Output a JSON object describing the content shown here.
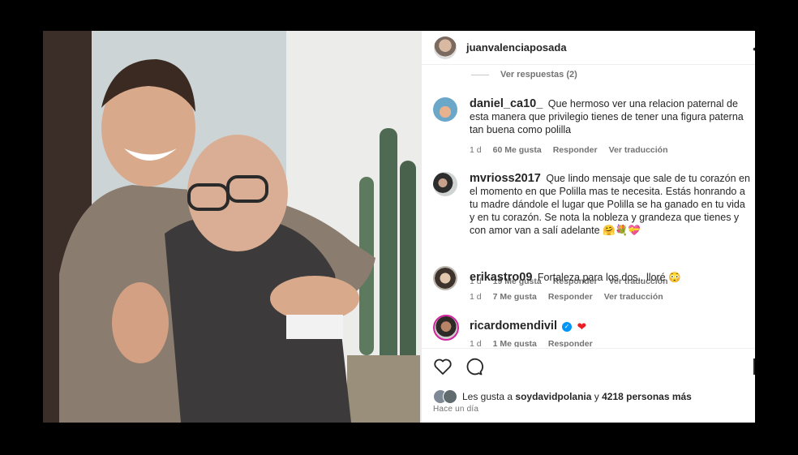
{
  "post": {
    "username": "juanvalenciaposada",
    "more_icon": "more-icon"
  },
  "thread": {
    "view_replies": "Ver respuestas (2)"
  },
  "comments": [
    {
      "username": "daniel_ca10_",
      "text": "Que hermoso ver una relacion paternal de esta manera que privilegio tienes de tener una figura paterna tan buena como polilla",
      "time": "1 d",
      "likes": "60 Me gusta",
      "reply": "Responder",
      "translate": "Ver traducción"
    },
    {
      "username": "mvrioss2017",
      "text": "Que lindo mensaje que sale de tu corazón en el momento en que Polilla mas te necesita. Estás honrando a tu madre dándole el lugar que Polilla se ha ganado en tu vida y en tu corazón. Se nota la nobleza y grandeza que tienes y con amor van a salí adelante 🤗💐💝",
      "time": "1 d",
      "likes": "19 Me gusta",
      "reply": "Responder",
      "translate": "Ver traducción"
    },
    {
      "username": "erikastro09",
      "text": "Fortaleza para los dos.. lloré 😳",
      "time": "1 d",
      "likes": "7 Me gusta",
      "reply": "Responder",
      "translate": "Ver traducción"
    },
    {
      "username": "ricardomendivil",
      "text": "",
      "heart": "❤",
      "verified_mark": "✓",
      "time": "1 d",
      "likes": "1 Me gusta",
      "reply": "Responder"
    }
  ],
  "footer": {
    "likes_prefix": "Les gusta a",
    "liker": "soydavidpolania",
    "likes_joiner": "y",
    "likes_count": "4218 personas más",
    "timestamp": "Hace un día"
  },
  "colors": {
    "text": "#262626",
    "muted": "#737373",
    "verified": "#0095f6",
    "heart": "#ed1c24"
  }
}
